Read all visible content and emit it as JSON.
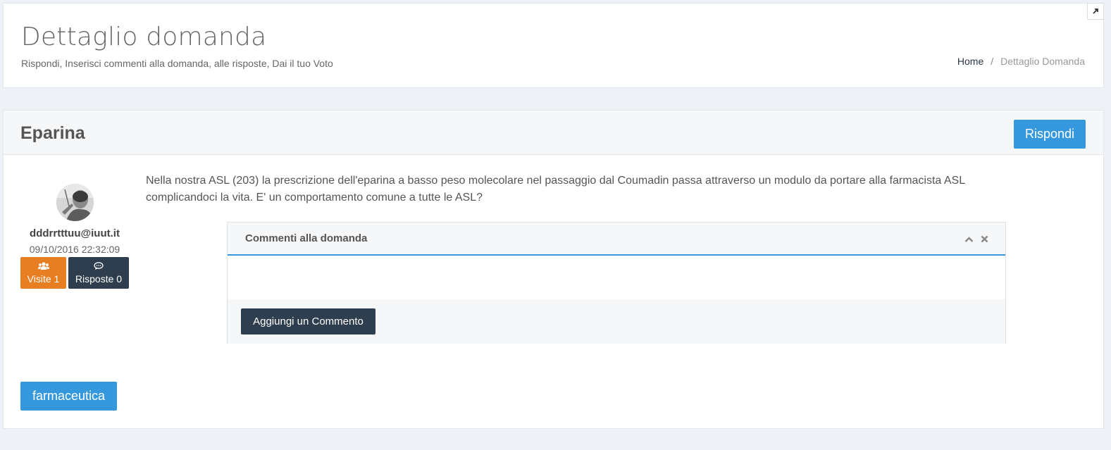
{
  "header": {
    "title": "Dettaglio domanda",
    "subtitle": "Rispondi, Inserisci commenti alla domanda, alle risposte, Dai il tuo Voto",
    "breadcrumb": {
      "home": "Home",
      "separator": "/",
      "current": "Dettaglio Domanda"
    }
  },
  "question": {
    "title": "Eparina",
    "reply_label": "Rispondi",
    "text": "Nella nostra ASL (203) la prescrizione dell'eparina a basso peso molecolare nel passaggio dal Coumadin passa attraverso un modulo da portare alla farmacista ASL complicandoci la vita. E' un comportamento comune a tutte le ASL?",
    "author": {
      "email": "dddrrtttuu@iuut.it",
      "date": "09/10/2016 22:32:09",
      "visits_label": "Visite 1",
      "answers_label": "Risposte 0",
      "visits_icon": "users-icon",
      "answers_icon": "comment-icon"
    },
    "comments": {
      "title": "Commenti alla domanda",
      "add_label": "Aggiungi un Commento"
    },
    "tag": "farmaceutica"
  },
  "colors": {
    "primary": "#3598dc",
    "orange": "#e87e22",
    "dark": "#2f3e4e",
    "background": "#eef1f5"
  }
}
